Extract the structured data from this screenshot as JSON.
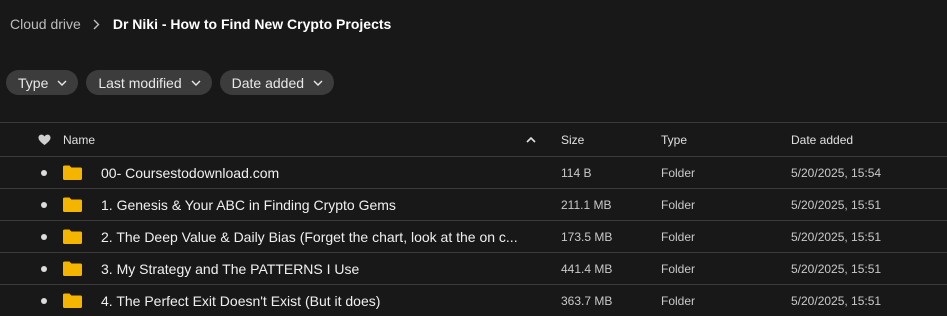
{
  "breadcrumb": {
    "root": "Cloud drive",
    "current": "Dr Niki - How to Find New Crypto Projects"
  },
  "filters": [
    {
      "label": "Type"
    },
    {
      "label": "Last modified"
    },
    {
      "label": "Date added"
    }
  ],
  "columns": {
    "name": "Name",
    "size": "Size",
    "type": "Type",
    "date": "Date added"
  },
  "colors": {
    "background": "#181818",
    "chip": "#3c3c3c",
    "folder": "#f5b400",
    "divider": "#3a3a3a"
  },
  "rows": [
    {
      "name": "00- Coursestodownload.com",
      "size": "114 B",
      "type": "Folder",
      "date": "5/20/2025, 15:54"
    },
    {
      "name": "1. Genesis & Your ABC in Finding Crypto Gems",
      "size": "211.1 MB",
      "type": "Folder",
      "date": "5/20/2025, 15:51"
    },
    {
      "name": "2. The Deep Value & Daily Bias (Forget the chart, look at the on c...",
      "size": "173.5 MB",
      "type": "Folder",
      "date": "5/20/2025, 15:51"
    },
    {
      "name": "3. My Strategy and The PATTERNS I Use",
      "size": "441.4 MB",
      "type": "Folder",
      "date": "5/20/2025, 15:51"
    },
    {
      "name": "4. The Perfect Exit Doesn't Exist (But it does)",
      "size": "363.7 MB",
      "type": "Folder",
      "date": "5/20/2025, 15:51"
    }
  ]
}
